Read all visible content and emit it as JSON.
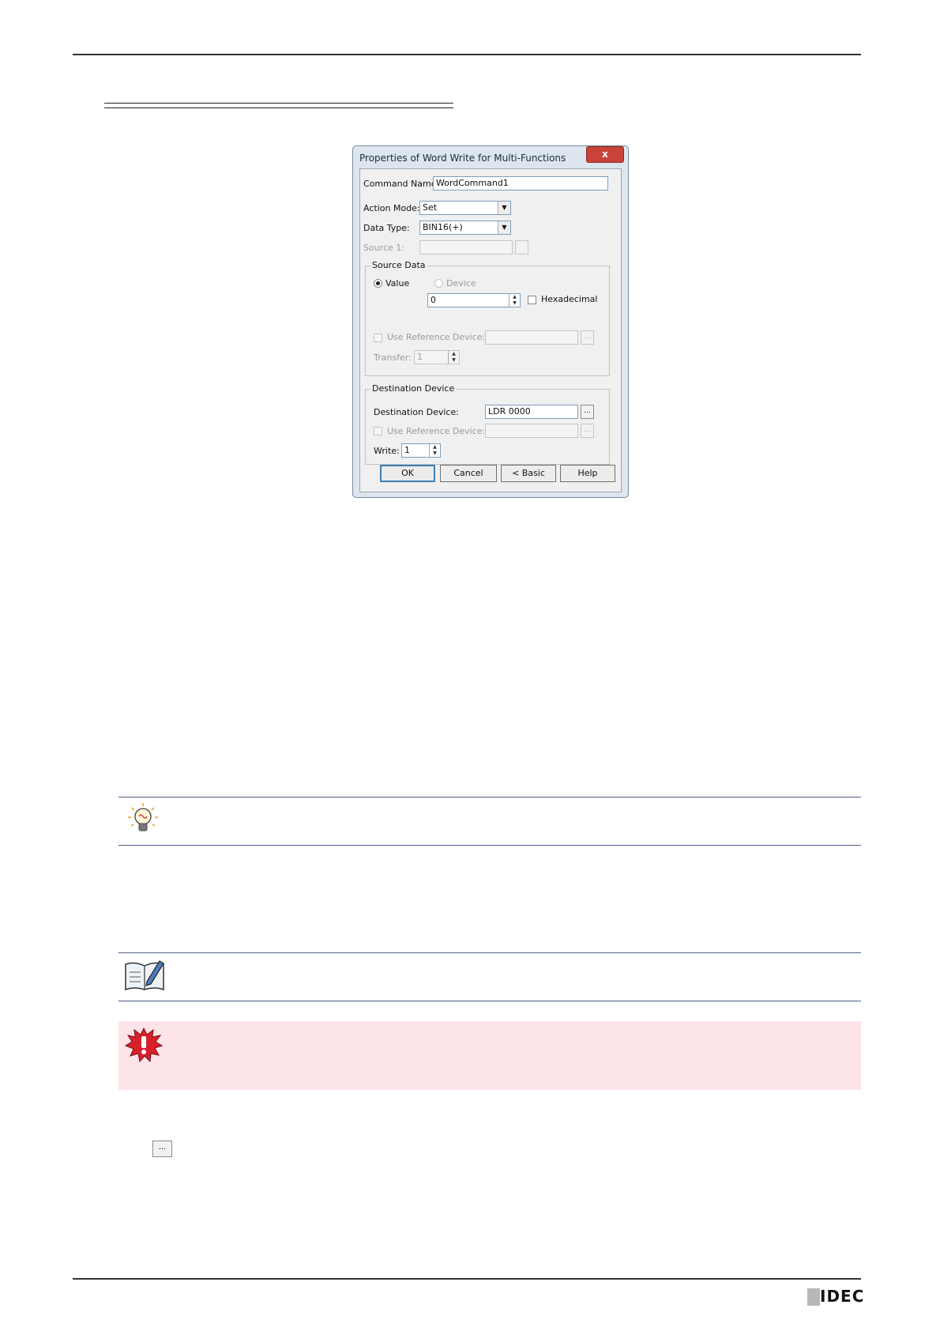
{
  "dialog": {
    "title": "Properties of Word Write for Multi-Functions",
    "close_label": "x",
    "command_name_label": "Command Name:",
    "command_name_value": "WordCommand1",
    "action_mode_label": "Action Mode:",
    "action_mode_value": "Set",
    "data_type_label": "Data Type:",
    "data_type_value": "BIN16(+)",
    "source1_label": "Source 1:",
    "source_data": {
      "group_label": "Source Data",
      "value_label": "Value",
      "device_label": "Device",
      "value_input": "0",
      "hexadecimal_label": "Hexadecimal",
      "use_reference_label": "Use Reference Device:",
      "transfer_label": "Transfer:",
      "transfer_value": "1"
    },
    "destination": {
      "group_label": "Destination Device",
      "device_label": "Destination Device:",
      "device_value": "LDR 0000",
      "use_reference_label": "Use Reference Device:",
      "write_label": "Write:",
      "write_value": "1"
    },
    "buttons": {
      "ok": "OK",
      "cancel": "Cancel",
      "basic": "< Basic",
      "help": "Help",
      "browse": "..."
    }
  },
  "footer": {
    "logo_text": "IDEC"
  },
  "standalone_browse_button": "..."
}
